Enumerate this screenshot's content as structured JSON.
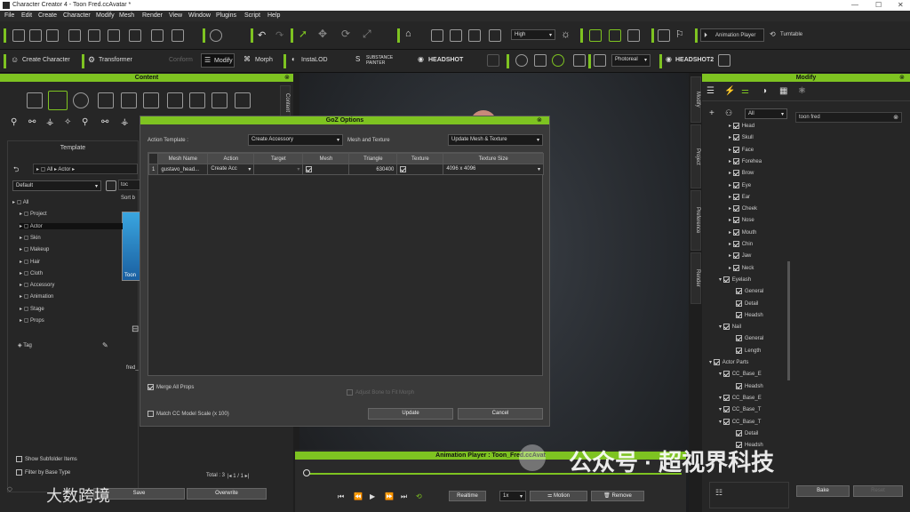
{
  "window": {
    "title": "Character Creator 4 - Toon Fred.ccAvatar *"
  },
  "menu": [
    "File",
    "Edit",
    "Create",
    "Character",
    "Modify",
    "Mesh",
    "Render",
    "View",
    "Window",
    "Plugins",
    "Script",
    "Help"
  ],
  "toolbar1": {
    "quality": "High",
    "anim_player": "Animation Player",
    "turntable": "Turntable"
  },
  "toolbar2": {
    "create_character": "Create Character",
    "transformer": "Transformer",
    "conform": "Conform",
    "modify": "Modify",
    "morph": "Morph",
    "instalod": "InstaLOD",
    "substance": "SUBSTANCE PAINTER",
    "headshot": "HEADSHOT",
    "render_mode": "Photoreal",
    "headshot2": "HEADSHOT2"
  },
  "content": {
    "header": "Content",
    "side_tab": "Content",
    "template_label": "Template",
    "breadcrumb_all": "All",
    "breadcrumb_actor": "Actor",
    "filter": "Default",
    "search_frag": "toc",
    "sort": "Sort b",
    "thumb_label": "Toon",
    "fred_label": "fred_",
    "tree": [
      "All",
      "Project",
      "Actor",
      "Skin",
      "Makeup",
      "Hair",
      "Cloth",
      "Accessory",
      "Animation",
      "Stage",
      "Props"
    ],
    "tag": "Tag",
    "show_subfolder": "Show Subfolder Items",
    "filter_base": "Filter by Base Type",
    "total": "Total : 3",
    "page": "1 / 1",
    "save": "Save",
    "overwrite": "Overwrite"
  },
  "dialog": {
    "title": "GoZ Options",
    "action_template_label": "Action Template :",
    "action_template": "Create Accessory",
    "mesh_texture_label": "Mesh and Texture",
    "mesh_texture": "Update Mesh & Texture",
    "columns": [
      "Mesh Name",
      "Action",
      "Target",
      "Mesh",
      "Triangle",
      "Texture",
      "Texture Size"
    ],
    "row": {
      "num": "1",
      "mesh_name": "gustavo_head...",
      "action": "Create Acc",
      "target": "",
      "triangle": "630400",
      "texture_size": "4096 x 4096"
    },
    "merge_props": "Merge All Props",
    "adjust_bone": "Adjust Bone to Fit Morph",
    "match_scale": "Match CC Model Scale (x 100)",
    "update": "Update",
    "cancel": "Cancel"
  },
  "right_tabs": [
    "Modify",
    "Project",
    "Preference",
    "Render"
  ],
  "modify": {
    "header": "Modify",
    "filter": "All",
    "search": "toon fred",
    "tree": [
      {
        "label": "Head",
        "d": 2,
        "exp": true
      },
      {
        "label": "Skull",
        "d": 2,
        "exp": true
      },
      {
        "label": "Face",
        "d": 2,
        "exp": true
      },
      {
        "label": "Forehea",
        "d": 2,
        "exp": true
      },
      {
        "label": "Brow",
        "d": 2,
        "exp": true
      },
      {
        "label": "Eye",
        "d": 2,
        "exp": true
      },
      {
        "label": "Ear",
        "d": 2,
        "exp": true
      },
      {
        "label": "Cheek",
        "d": 2,
        "exp": true
      },
      {
        "label": "Nose",
        "d": 2,
        "exp": true
      },
      {
        "label": "Mouth",
        "d": 2,
        "exp": true
      },
      {
        "label": "Chin",
        "d": 2,
        "exp": true
      },
      {
        "label": "Jaw",
        "d": 2,
        "exp": true
      },
      {
        "label": "Neck",
        "d": 2,
        "exp": true
      },
      {
        "label": "Eyelash",
        "d": 1,
        "exp": false
      },
      {
        "label": "General",
        "d": 2,
        "exp": false
      },
      {
        "label": "Detail",
        "d": 2,
        "exp": false
      },
      {
        "label": "Headsh",
        "d": 2,
        "exp": false
      },
      {
        "label": "Nail",
        "d": 1,
        "exp": false
      },
      {
        "label": "General",
        "d": 2,
        "exp": false
      },
      {
        "label": "Length",
        "d": 2,
        "exp": false
      },
      {
        "label": "Actor Parts",
        "d": 0,
        "exp": false
      },
      {
        "label": "CC_Base_E",
        "d": 1,
        "exp": false
      },
      {
        "label": "Headsh",
        "d": 2,
        "exp": false
      },
      {
        "label": "CC_Base_E",
        "d": 1,
        "exp": false
      },
      {
        "label": "CC_Base_T",
        "d": 1,
        "exp": false
      },
      {
        "label": "CC_Base_T",
        "d": 1,
        "exp": false
      },
      {
        "label": "Detail",
        "d": 2,
        "exp": false
      },
      {
        "label": "Headsh",
        "d": 2,
        "exp": false
      }
    ],
    "bake": "Bake",
    "reset": "Reset"
  },
  "anim": {
    "header": "Animation Player : Toon_Fred.ccAvat",
    "realtime": "Realtime",
    "speed": "1x",
    "motion": "Motion",
    "remove": "Remove"
  },
  "watermarks": {
    "wechat": "公众号 · 超视界科技",
    "bottom": "大数跨境"
  }
}
